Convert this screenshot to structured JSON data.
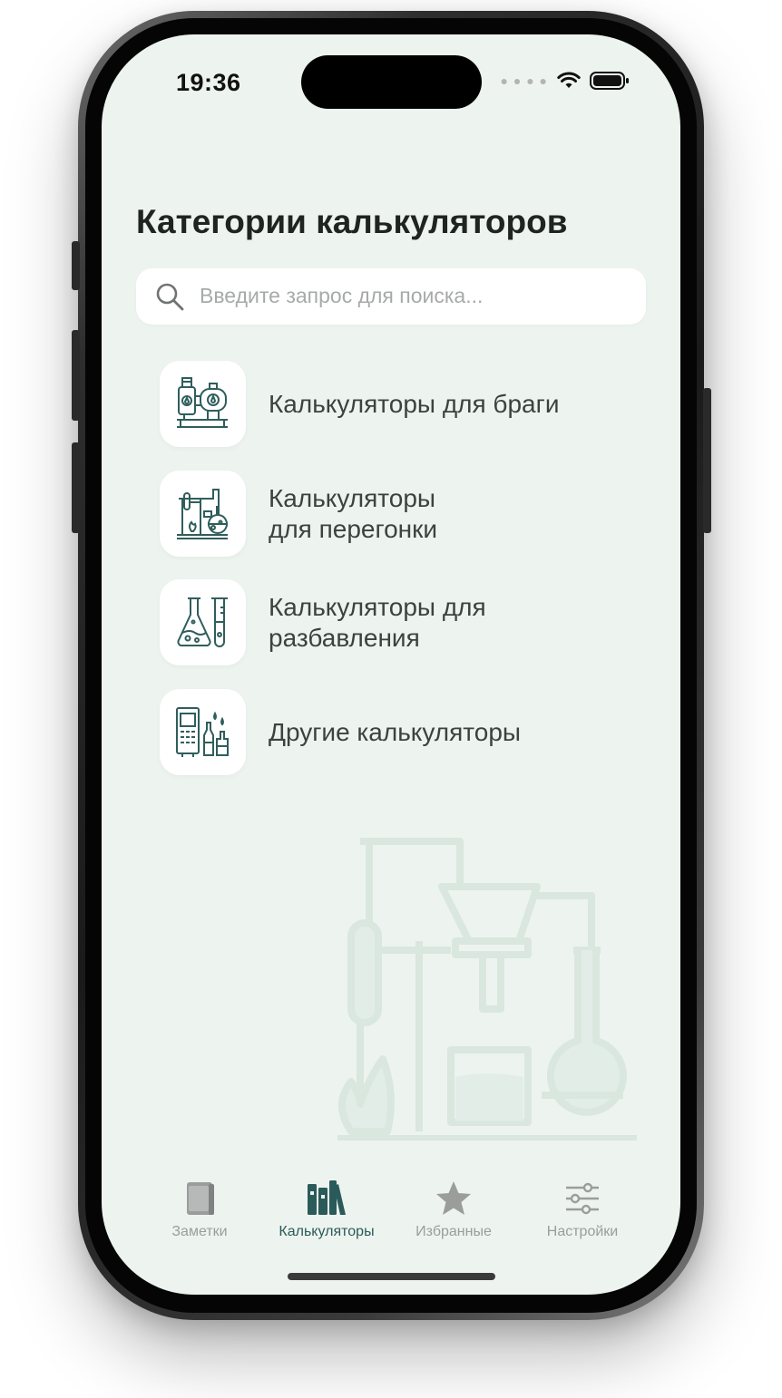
{
  "status_bar": {
    "time": "19:36"
  },
  "page": {
    "title": "Категории калькуляторов",
    "search_placeholder": "Введите запрос для поиска..."
  },
  "categories": [
    {
      "label_line1": "Калькуляторы для браги",
      "label_line2": "",
      "icon": "brewing-equipment-icon"
    },
    {
      "label_line1": "Калькуляторы",
      "label_line2": "для перегонки",
      "icon": "distillation-apparatus-icon"
    },
    {
      "label_line1": "Калькуляторы для",
      "label_line2": "разбавления",
      "icon": "lab-flasks-icon"
    },
    {
      "label_line1": "Другие калькуляторы",
      "label_line2": "",
      "icon": "meter-and-bottles-icon"
    }
  ],
  "tabs": [
    {
      "label": "Заметки",
      "icon": "notebook-icon",
      "active": false
    },
    {
      "label": "Калькуляторы",
      "icon": "books-icon",
      "active": true
    },
    {
      "label": "Избранные",
      "icon": "star-icon",
      "active": false
    },
    {
      "label": "Настройки",
      "icon": "sliders-icon",
      "active": false
    }
  ],
  "colors": {
    "background": "#edf4ef",
    "accent": "#2b5a5a",
    "icon_stroke": "#2f5e5c",
    "inactive": "#9a9d9c"
  }
}
